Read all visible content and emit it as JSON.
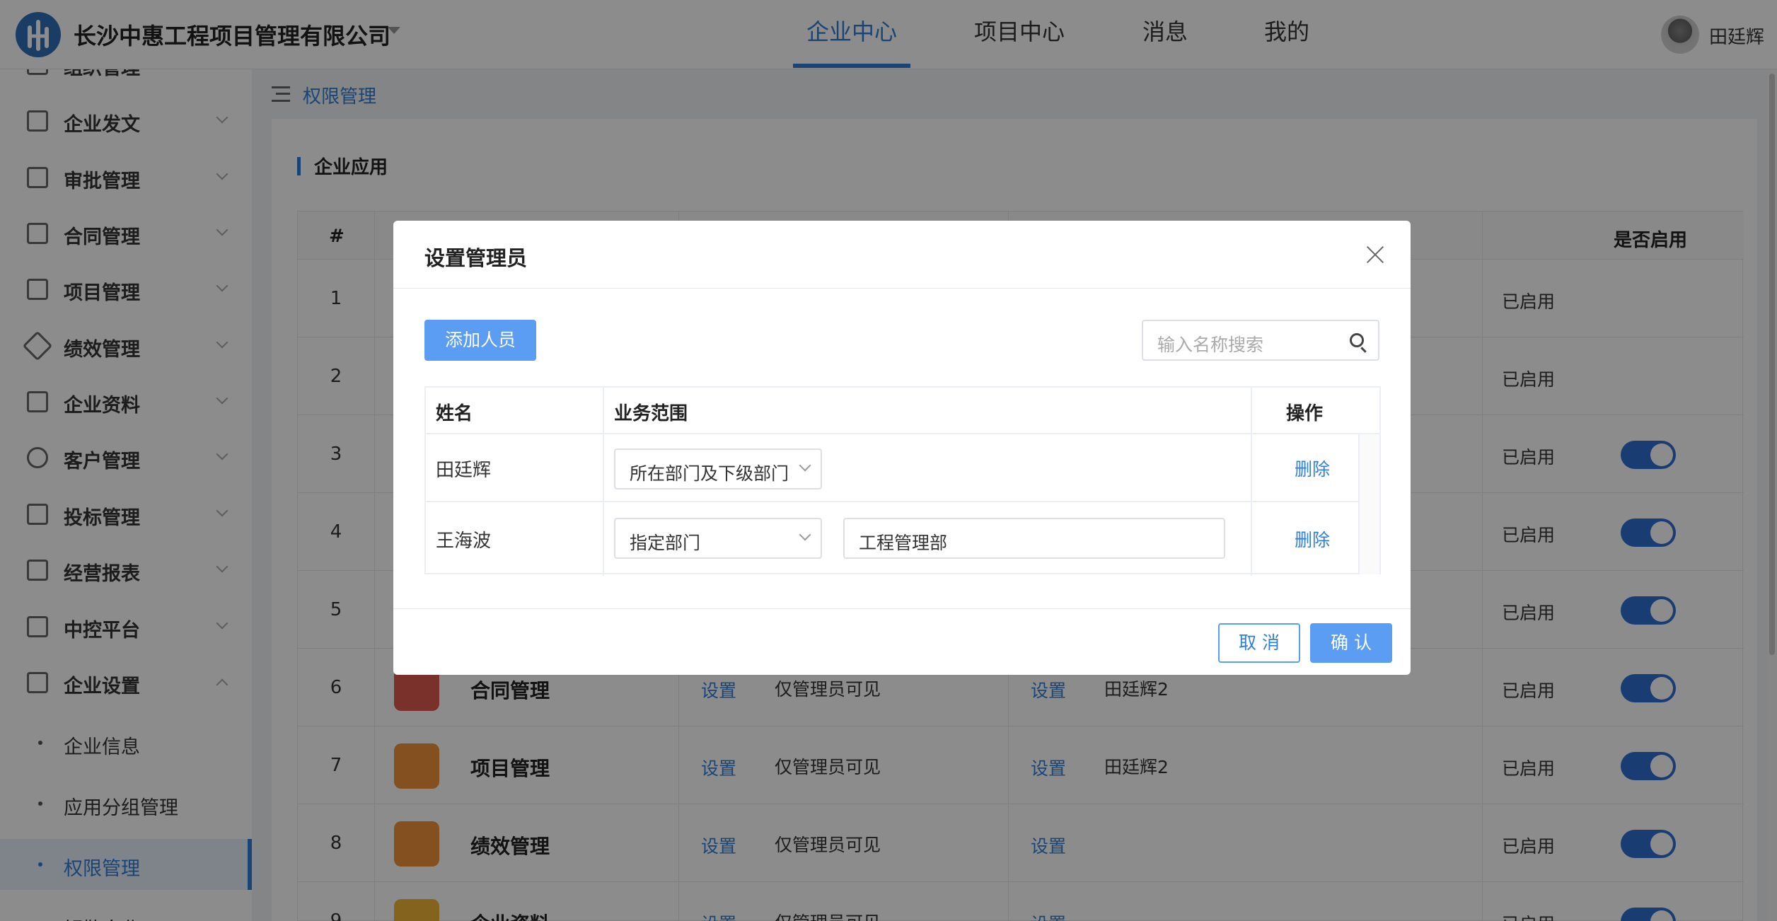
{
  "header": {
    "company": "长沙中惠工程项目管理有限公司",
    "tabs": [
      "企业中心",
      "项目中心",
      "消息",
      "我的"
    ],
    "active_tab": "企业中心",
    "user": "田廷辉"
  },
  "sidebar": {
    "partial_top": "组织管理",
    "items": [
      {
        "label": "企业发文",
        "icon": "document-icon"
      },
      {
        "label": "审批管理",
        "icon": "stamp-icon"
      },
      {
        "label": "合同管理",
        "icon": "contract-icon"
      },
      {
        "label": "项目管理",
        "icon": "list-icon"
      },
      {
        "label": "绩效管理",
        "icon": "diamond-icon"
      },
      {
        "label": "企业资料",
        "icon": "folder-icon"
      },
      {
        "label": "客户管理",
        "icon": "users-icon"
      },
      {
        "label": "投标管理",
        "icon": "triangle-icon"
      },
      {
        "label": "经营报表",
        "icon": "chart-icon"
      },
      {
        "label": "中控平台",
        "icon": "building-icon"
      },
      {
        "label": "企业设置",
        "icon": "building-settings-icon"
      }
    ],
    "sub_items": [
      "企业信息",
      "应用分组管理",
      "权限管理",
      "解散企业"
    ],
    "active_sub": "权限管理"
  },
  "breadcrumb": "权限管理",
  "section_title": "企业应用",
  "bg_table": {
    "headers": {
      "index": "#",
      "enabled": "是否启用"
    },
    "rows": [
      {
        "num": "1",
        "status": "已启用",
        "toggle": false
      },
      {
        "num": "2",
        "status": "已启用",
        "toggle": false
      },
      {
        "num": "3",
        "status": "已启用",
        "toggle": true
      },
      {
        "num": "4",
        "status": "已启用",
        "toggle": true
      },
      {
        "num": "5",
        "status": "已启用",
        "toggle": true
      },
      {
        "num": "6",
        "status": "已启用",
        "toggle": true,
        "app": "合同管理",
        "link1": "设置",
        "visibility": "仅管理员可见",
        "link2": "设置",
        "admin": "田廷辉2",
        "icon_color": "#e05a4f"
      },
      {
        "num": "7",
        "status": "已启用",
        "toggle": true,
        "app": "项目管理",
        "link1": "设置",
        "visibility": "仅管理员可见",
        "link2": "设置",
        "admin": "田廷辉2",
        "icon_color": "#f0923a"
      },
      {
        "num": "8",
        "status": "已启用",
        "toggle": true,
        "app": "绩效管理",
        "link1": "设置",
        "visibility": "仅管理员可见",
        "link2": "设置",
        "admin": "",
        "icon_color": "#f0923a"
      },
      {
        "num": "9",
        "status": "已启用",
        "toggle": true,
        "app": "企业资料",
        "link1": "设置",
        "visibility": "仅管理员可见",
        "link2": "设置",
        "admin": "",
        "icon_color": "#f0b43a"
      }
    ]
  },
  "modal": {
    "title": "设置管理员",
    "add_button": "添加人员",
    "search_placeholder": "输入名称搜索",
    "columns": {
      "name": "姓名",
      "scope": "业务范围",
      "action": "操作"
    },
    "rows": [
      {
        "name": "田廷辉",
        "scope": "所在部门及下级部门",
        "dept": "",
        "action": "删除"
      },
      {
        "name": "王海波",
        "scope": "指定部门",
        "dept": "工程管理部",
        "action": "删除"
      }
    ],
    "cancel": "取 消",
    "confirm": "确 认"
  }
}
